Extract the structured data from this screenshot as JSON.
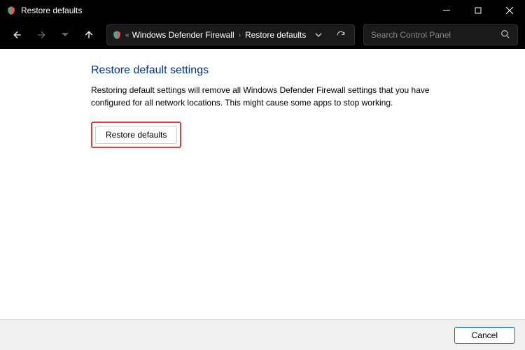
{
  "window": {
    "title": "Restore defaults"
  },
  "breadcrumb": {
    "item1": "Windows Defender Firewall",
    "item2": "Restore defaults"
  },
  "search": {
    "placeholder": "Search Control Panel"
  },
  "page": {
    "title": "Restore default settings",
    "description": "Restoring default settings will remove all Windows Defender Firewall settings that you have configured for all network locations. This might cause some apps to stop working.",
    "restoreBtn": "Restore defaults"
  },
  "footer": {
    "cancel": "Cancel"
  }
}
